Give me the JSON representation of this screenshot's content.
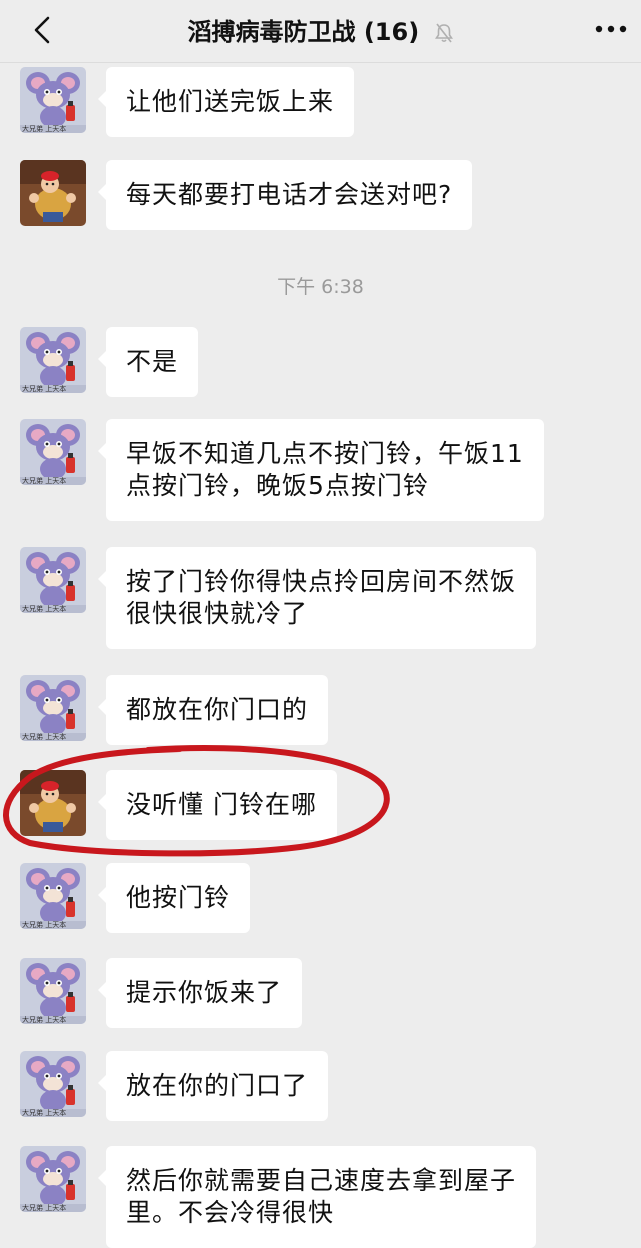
{
  "header": {
    "title": "滔搏病毒防卫战 (16)",
    "back_icon": "chevron-left-icon",
    "mute_icon": "bell-muted-icon",
    "more_icon": "more-dots-icon"
  },
  "timestamp": "下午 6:38",
  "avatars": {
    "mouse": "cartoon-mouse-avatar",
    "boy": "cartoon-boy-avatar"
  },
  "messages": [
    {
      "sender": "mouse",
      "text": "让他们送完饭上来"
    },
    {
      "sender": "boy",
      "text": "每天都要打电话才会送对吧?"
    },
    {
      "sender": "mouse",
      "text": "不是"
    },
    {
      "sender": "mouse",
      "lines": [
        "早饭不知道几点不按门铃，午饭11",
        "点按门铃，晚饭5点按门铃"
      ]
    },
    {
      "sender": "mouse",
      "lines": [
        "按了门铃你得快点拎回房间不然饭",
        "很快很快就冷了"
      ]
    },
    {
      "sender": "mouse",
      "text": "都放在你门口的"
    },
    {
      "sender": "boy",
      "text": "没听懂 门铃在哪",
      "highlighted": true
    },
    {
      "sender": "mouse",
      "text": "他按门铃"
    },
    {
      "sender": "mouse",
      "text": "提示你饭来了"
    },
    {
      "sender": "mouse",
      "text": "放在你的门口了"
    },
    {
      "sender": "mouse",
      "lines": [
        "然后你就需要自己速度去拿到屋子",
        "里。不会冷得很快"
      ]
    }
  ],
  "colors": {
    "highlight_circle": "#c8171d",
    "bubble": "#ffffff",
    "background": "#ededed"
  }
}
